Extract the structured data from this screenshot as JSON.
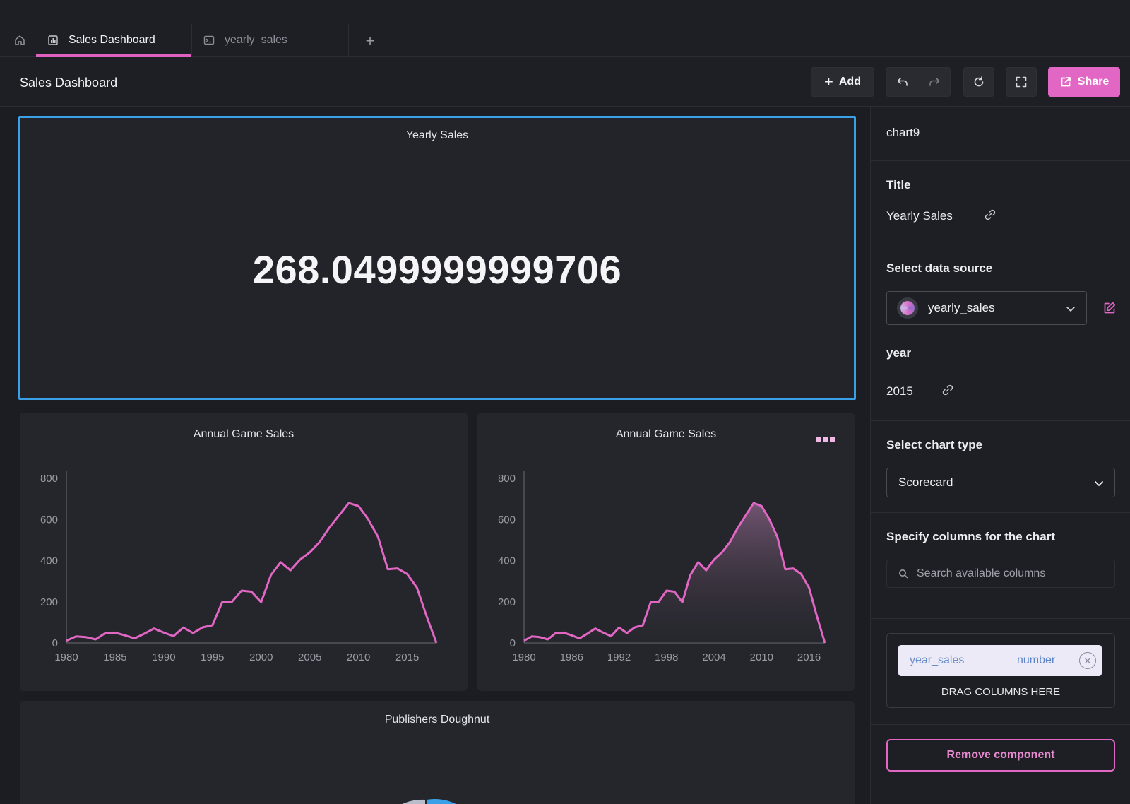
{
  "tabs": {
    "home_icon": "home-icon",
    "items": [
      {
        "label": "Sales Dashboard",
        "icon": "dashboard-icon",
        "active": true
      },
      {
        "label": "yearly_sales",
        "icon": "terminal-icon",
        "active": false
      }
    ],
    "add_label": "+"
  },
  "header": {
    "title": "Sales Dashboard",
    "add_label": "Add",
    "share_label": "Share"
  },
  "colors": {
    "accent": "#e266c4",
    "selection": "#3aa0e8",
    "background": "#1c1d22",
    "card": "#25262c"
  },
  "scorecard": {
    "title": "Yearly Sales",
    "value": "268.0499999999706"
  },
  "annual_line": {
    "title": "Annual Game Sales"
  },
  "annual_area": {
    "title": "Annual Game Sales"
  },
  "doughnut": {
    "title": "Publishers Doughnut"
  },
  "chart_data": [
    {
      "type": "line",
      "title": "Annual Game Sales",
      "x": [
        1980,
        1981,
        1982,
        1983,
        1984,
        1985,
        1986,
        1987,
        1988,
        1989,
        1990,
        1991,
        1992,
        1993,
        1994,
        1995,
        1996,
        1997,
        1998,
        1999,
        2000,
        2001,
        2002,
        2003,
        2004,
        2005,
        2006,
        2007,
        2008,
        2009,
        2010,
        2011,
        2012,
        2013,
        2014,
        2015,
        2016,
        2017,
        2018
      ],
      "y": [
        11,
        32,
        28,
        17,
        48,
        50,
        37,
        22,
        45,
        70,
        50,
        33,
        75,
        48,
        76,
        86,
        198,
        200,
        254,
        249,
        198,
        330,
        392,
        353,
        405,
        440,
        490,
        560,
        620,
        680,
        665,
        600,
        515,
        358,
        362,
        335,
        268,
        128,
        0
      ],
      "xlim": [
        1980,
        2018
      ],
      "ylim": [
        0,
        800
      ],
      "xticks": [
        "1980",
        "1985",
        "1990",
        "1995",
        "2000",
        "2005",
        "2010",
        "2015"
      ],
      "yticks": [
        "0",
        "200",
        "400",
        "600",
        "800"
      ],
      "color": "#e266c4"
    },
    {
      "type": "area",
      "title": "Annual Game Sales",
      "x": [
        1980,
        1981,
        1982,
        1983,
        1984,
        1985,
        1986,
        1987,
        1988,
        1989,
        1990,
        1991,
        1992,
        1993,
        1994,
        1995,
        1996,
        1997,
        1998,
        1999,
        2000,
        2001,
        2002,
        2003,
        2004,
        2005,
        2006,
        2007,
        2008,
        2009,
        2010,
        2011,
        2012,
        2013,
        2014,
        2015,
        2016,
        2017,
        2018
      ],
      "y": [
        11,
        32,
        28,
        17,
        48,
        50,
        37,
        22,
        45,
        70,
        50,
        33,
        75,
        48,
        76,
        86,
        198,
        200,
        254,
        249,
        198,
        330,
        392,
        353,
        405,
        440,
        490,
        560,
        620,
        680,
        665,
        600,
        515,
        358,
        362,
        335,
        268,
        128,
        0
      ],
      "xlim": [
        1980,
        2018
      ],
      "ylim": [
        0,
        800
      ],
      "xticks": [
        "1980",
        "1986",
        "1992",
        "1998",
        "2004",
        "2010",
        "2016"
      ],
      "yticks": [
        "0",
        "200",
        "400",
        "600",
        "800"
      ],
      "color": "#e266c4"
    }
  ],
  "panel": {
    "component_id": "chart9",
    "title_label": "Title",
    "title_value": "Yearly Sales",
    "data_source_label": "Select data source",
    "data_source_value": "yearly_sales",
    "param_name": "year",
    "param_value": "2015",
    "chart_type_label": "Select chart type",
    "chart_type_value": "Scorecard",
    "columns_label": "Specify columns for the chart",
    "search_placeholder": "Search available columns",
    "column_chip": {
      "name": "year_sales",
      "type": "number"
    },
    "drop_hint": "DRAG COLUMNS HERE",
    "remove_label": "Remove component"
  }
}
